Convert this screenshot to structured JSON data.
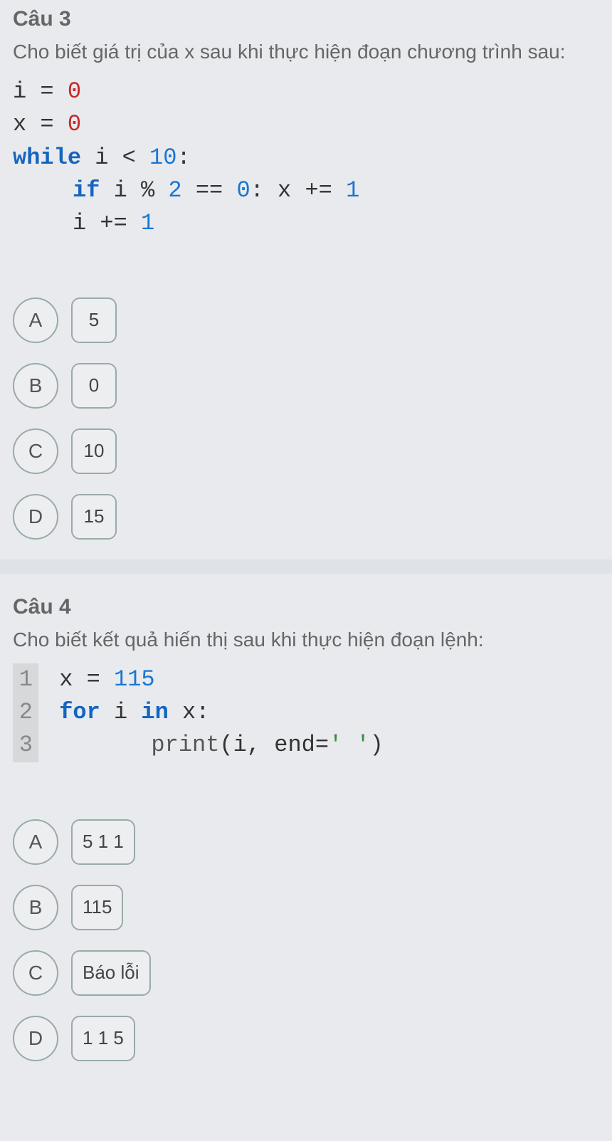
{
  "q3": {
    "title": "Câu 3",
    "prompt": "Cho biết giá trị của x sau khi thực hiện đoạn chương trình sau:",
    "code": {
      "l1_i": "i",
      "l1_eq": "=",
      "l1_v": "0",
      "l2_x": "x",
      "l2_eq": "=",
      "l2_v": "0",
      "l3_while": "while",
      "l3_i": "i",
      "l3_lt": "<",
      "l3_10": "10",
      "l3_colon": ":",
      "l4_if": "if",
      "l4_i": "i",
      "l4_pct": "%",
      "l4_2": "2",
      "l4_eqeq": "==",
      "l4_0": "0",
      "l4_colon": ":",
      "l4_x": "x",
      "l4_pluseq": "+=",
      "l4_1": "1",
      "l5_i": "i",
      "l5_pluseq": "+=",
      "l5_1": "1"
    },
    "options": [
      {
        "letter": "A",
        "value": "5"
      },
      {
        "letter": "B",
        "value": "0"
      },
      {
        "letter": "C",
        "value": "10"
      },
      {
        "letter": "D",
        "value": "15"
      }
    ]
  },
  "q4": {
    "title": "Câu 4",
    "prompt": "Cho biết kết quả hiến thị sau khi thực hiện đoạn lệnh:",
    "code": {
      "ln1": "1",
      "ln2": "2",
      "ln3": "3",
      "l1_x": "x",
      "l1_eq": "=",
      "l1_115": "115",
      "l2_for": "for",
      "l2_i": "i",
      "l2_in": "in",
      "l2_x": "x",
      "l2_colon": ":",
      "l3_print": "print",
      "l3_open": "(",
      "l3_i": "i",
      "l3_comma": ",",
      "l3_end": "end",
      "l3_eq": "=",
      "l3_str": "' '",
      "l3_close": ")"
    },
    "options": [
      {
        "letter": "A",
        "value": "5 1 1"
      },
      {
        "letter": "B",
        "value": "115"
      },
      {
        "letter": "C",
        "value": "Báo lỗi"
      },
      {
        "letter": "D",
        "value": "1 1 5"
      }
    ]
  }
}
